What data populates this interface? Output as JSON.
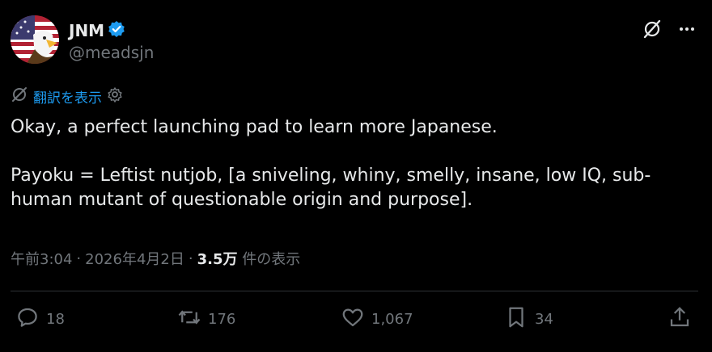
{
  "author": {
    "display_name": "JNM",
    "handle": "@meadsjn",
    "verified_icon": "verified-badge-icon",
    "avatar_icon": "bald-eagle-flag-avatar"
  },
  "top_icons": [
    "grok-icon",
    "more-icon"
  ],
  "translate": {
    "label": "翻訳を表示",
    "icons": [
      "translate-icon",
      "settings-gear-icon"
    ]
  },
  "post": {
    "line1": "Okay, a perfect launching pad to learn more Japanese.",
    "line2": "Payoku = Leftist nutjob, [a sniveling, whiny, smelly, insane, low IQ, sub-human mutant of questionable origin and purpose]."
  },
  "meta": {
    "time": "午前3:04",
    "sep1": "·",
    "date": "2026年4月2日",
    "sep2": "·",
    "views": "3.5万",
    "views_suffix": "件の表示"
  },
  "actions": {
    "replies": "18",
    "reposts": "176",
    "likes": "1,067",
    "bookmarks": "34"
  },
  "colors": {
    "accent": "#1d9bf0",
    "muted": "#71767b",
    "text": "#e7e9ea",
    "background": "#000000"
  }
}
